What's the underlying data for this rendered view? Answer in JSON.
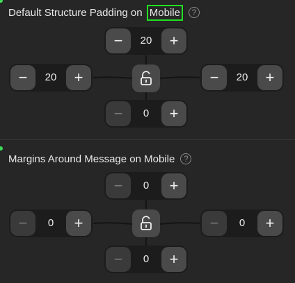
{
  "padding_section": {
    "title_prefix": "Default Structure Padding on",
    "title_highlight": "Mobile",
    "help_glyph": "?",
    "top_value": "20",
    "left_value": "20",
    "right_value": "20",
    "bottom_value": "0"
  },
  "margins_section": {
    "title": "Margins Around Message on Mobile",
    "help_glyph": "?",
    "top_value": "0",
    "left_value": "0",
    "right_value": "0",
    "bottom_value": "0"
  },
  "glyphs": {
    "minus": "−",
    "plus": "+"
  },
  "colors": {
    "background": "#262626",
    "button": "#4a4a4a",
    "button_disabled": "#3a3a3a",
    "highlight_box": "#22e022",
    "indicator_dot": "#3ddc57"
  },
  "icons": [
    "help-icon",
    "unlock-icon",
    "minus-icon",
    "plus-icon"
  ]
}
